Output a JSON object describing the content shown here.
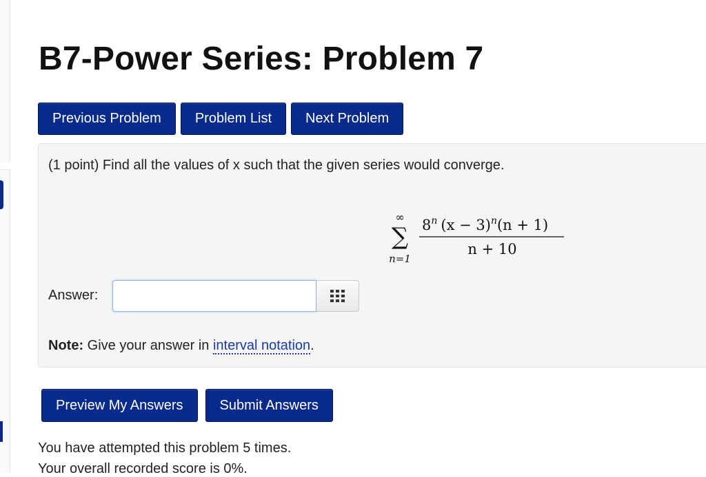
{
  "page": {
    "title": "B7-Power Series: Problem 7"
  },
  "nav": {
    "previous_label": "Previous Problem",
    "list_label": "Problem List",
    "next_label": "Next Problem"
  },
  "problem": {
    "prompt": "(1 point) Find all the values of x such that the given series would converge.",
    "formula": {
      "sum_upper": "∞",
      "sum_lower": "n=1",
      "sigma": "∑",
      "numerator_base": "8",
      "numerator_exp": "n",
      "numerator_middle": "(x − 3)",
      "numerator_exp2": "n",
      "numerator_tail": "(n + 1)",
      "denominator": "n + 10"
    },
    "answer_label": "Answer:",
    "answer_value": "",
    "note_label": "Note:",
    "note_text": " Give your answer in ",
    "note_link": "interval notation",
    "note_end": "."
  },
  "actions": {
    "preview_label": "Preview My Answers",
    "submit_label": "Submit Answers"
  },
  "status": {
    "attempts": "You have attempted this problem 5 times.",
    "score": "Your overall recorded score is 0%."
  },
  "icons": {
    "equation_editor": "grid-icon"
  },
  "colors": {
    "button": "#082a8a",
    "link": "#1a3aa8",
    "panel": "#f5f5f5"
  }
}
